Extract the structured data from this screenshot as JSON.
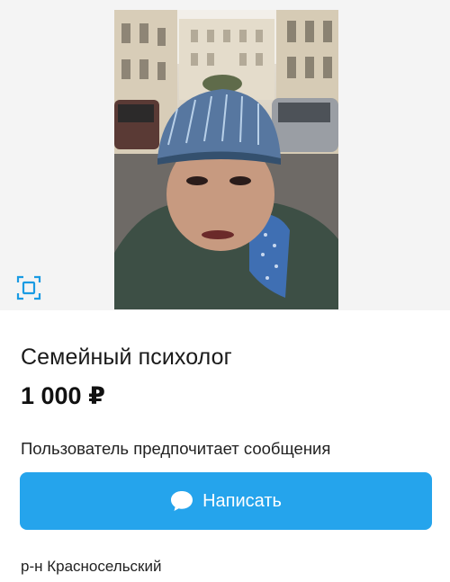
{
  "listing": {
    "title": "Семейный психолог",
    "price": "1 000 ₽",
    "contact_preference": "Пользователь предпочитает сообщения",
    "write_button_label": "Написать",
    "district": "р-н Красносельский"
  },
  "colors": {
    "accent": "#25a4ec",
    "icon": "#1a9be3"
  },
  "icons": {
    "expand": "expand-icon",
    "message": "chat-bubble-icon"
  }
}
